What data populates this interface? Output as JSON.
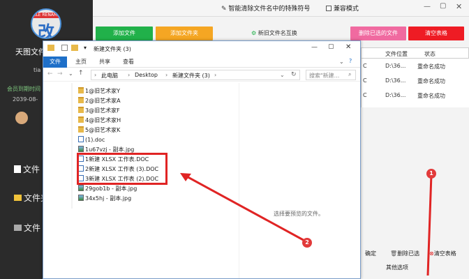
{
  "sidebar": {
    "app_name": "天图文件",
    "user": "tia",
    "member_label": "会员到期时间",
    "expire_date": "2039-08-",
    "menu": [
      "文件",
      "文件夹",
      "文件"
    ]
  },
  "topbar": {
    "tool_title": "智能清除文件名中的特殊符号",
    "compat_label": "兼容模式"
  },
  "toolbar": {
    "add_file": "添加文件",
    "add_folder": "添加文件夹",
    "swap_names": "新旧文件名互换",
    "delete_selected": "删除已选的文件",
    "clear_table": "清空表格"
  },
  "table": {
    "headers": [
      "文件位置",
      "状态"
    ],
    "rows": [
      {
        "loc": "D:\\36...",
        "status": "重命名成功"
      },
      {
        "loc": "D:\\36...",
        "status": "重命名成功"
      },
      {
        "loc": "D:\\36...",
        "status": "重命名成功"
      }
    ]
  },
  "bottom": {
    "confirm": "确定",
    "delete_selected": "删除已选",
    "clear_table": "清空表格",
    "other_options": "其他选项"
  },
  "explorer": {
    "title": "新建文件夹 (3)",
    "ribbon_tabs": [
      "文件",
      "主页",
      "共享",
      "查看"
    ],
    "breadcrumb": [
      "此电脑",
      "Desktop",
      "新建文件夹 (3)"
    ],
    "search_placeholder": "搜索\"新建...",
    "preview_text": "选择要预览的文件。",
    "files": [
      {
        "name": "1@旧艺术家Y",
        "type": "folder"
      },
      {
        "name": "2@旧艺术家A",
        "type": "folder"
      },
      {
        "name": "3@旧艺术家F",
        "type": "folder"
      },
      {
        "name": "4@旧艺术家H",
        "type": "folder"
      },
      {
        "name": "5@旧艺术家K",
        "type": "folder"
      },
      {
        "name": "(1).doc",
        "type": "doc"
      },
      {
        "name": "1u67vzj - 副本.jpg",
        "type": "jpg"
      },
      {
        "name": "1新建 XLSX 工作表.DOC",
        "type": "doc"
      },
      {
        "name": "2新建 XLSX 工作表 (3).DOC",
        "type": "doc"
      },
      {
        "name": "3新建 XLSX 工作表 (2).DOC",
        "type": "doc"
      },
      {
        "name": "29gob1b - 副本.jpg",
        "type": "jpg"
      },
      {
        "name": "34x5hj - 副本.jpg",
        "type": "jpg"
      }
    ]
  },
  "markers": {
    "m1": "1",
    "m2": "2"
  },
  "colors": {
    "accent_red": "#e02424",
    "green_btn": "#21b14a",
    "orange_btn": "#f5a623",
    "pink_btn": "#f06aa0",
    "red_btn": "#ee1c24"
  }
}
